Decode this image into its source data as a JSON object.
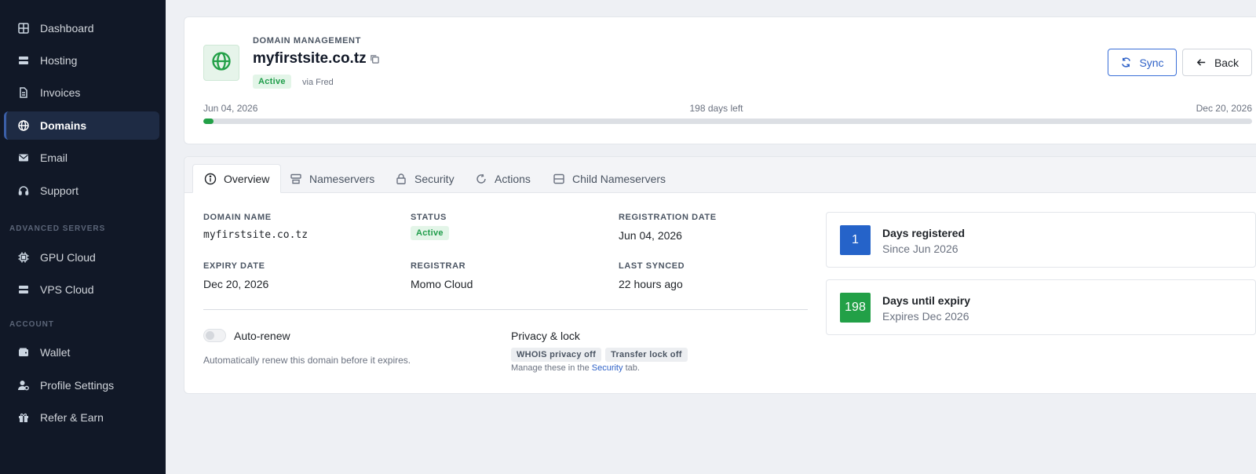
{
  "sidebar": {
    "items": [
      {
        "label": "Dashboard",
        "icon": "grid-icon"
      },
      {
        "label": "Hosting",
        "icon": "server-icon"
      },
      {
        "label": "Invoices",
        "icon": "document-icon"
      },
      {
        "label": "Domains",
        "icon": "globe-icon",
        "active": true
      },
      {
        "label": "Email",
        "icon": "envelope-icon"
      },
      {
        "label": "Support",
        "icon": "headset-icon"
      }
    ],
    "advanced_title": "ADVANCED SERVERS",
    "advanced_items": [
      {
        "label": "GPU Cloud",
        "icon": "chip-icon"
      },
      {
        "label": "VPS Cloud",
        "icon": "server-icon"
      }
    ],
    "account_title": "ACCOUNT",
    "account_items": [
      {
        "label": "Wallet",
        "icon": "wallet-icon"
      },
      {
        "label": "Profile Settings",
        "icon": "user-gear-icon"
      },
      {
        "label": "Refer & Earn",
        "icon": "gift-icon"
      }
    ]
  },
  "header": {
    "eyebrow": "DOMAIN MANAGEMENT",
    "domain": "myfirstsite.co.tz",
    "status": "Active",
    "via": "via Fred",
    "sync_label": "Sync",
    "back_label": "Back",
    "start_date": "Jun 04, 2026",
    "days_left": "198 days left",
    "end_date": "Dec 20, 2026",
    "progress_fraction": 0.005
  },
  "tabs": [
    {
      "label": "Overview",
      "icon": "info-icon",
      "active": true
    },
    {
      "label": "Nameservers",
      "icon": "server-icon"
    },
    {
      "label": "Security",
      "icon": "lock-icon"
    },
    {
      "label": "Actions",
      "icon": "refresh-icon"
    },
    {
      "label": "Child Nameservers",
      "icon": "server-icon"
    }
  ],
  "overview": {
    "domain_name_label": "DOMAIN NAME",
    "domain_name": "myfirstsite.co.tz",
    "status_label": "STATUS",
    "status": "Active",
    "registration_date_label": "REGISTRATION DATE",
    "registration_date": "Jun 04, 2026",
    "expiry_date_label": "EXPIRY DATE",
    "expiry_date": "Dec 20, 2026",
    "registrar_label": "REGISTRAR",
    "registrar": "Momo Cloud",
    "last_synced_label": "LAST SYNCED",
    "last_synced": "22 hours ago",
    "auto_renew_label": "Auto-renew",
    "auto_renew_enabled": false,
    "auto_renew_desc": "Automatically renew this domain before it expires.",
    "privacy_title": "Privacy & lock",
    "whois_pill": "WHOIS privacy off",
    "transfer_pill": "Transfer lock off",
    "manage_prefix": "Manage these in the",
    "manage_link": "Security",
    "manage_suffix": "tab."
  },
  "stats": [
    {
      "value": "1",
      "title": "Days registered",
      "subtitle": "Since Jun 2026",
      "color": "#2563c9"
    },
    {
      "value": "198",
      "title": "Days until expiry",
      "subtitle": "Expires Dec 2026",
      "color": "#22a047"
    }
  ],
  "colors": {
    "sidebar_bg": "#111827",
    "accent": "#2f62c8",
    "success": "#22a047"
  }
}
